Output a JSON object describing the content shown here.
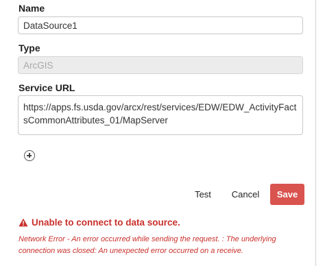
{
  "form": {
    "name_label": "Name",
    "name_value": "DataSource1",
    "type_label": "Type",
    "type_value": "ArcGIS",
    "url_label": "Service URL",
    "url_value": "https://apps.fs.usda.gov/arcx/rest/services/EDW/EDW_ActivityFactsCommonAttributes_01/MapServer",
    "add_icon": "plus-circle-icon"
  },
  "actions": {
    "test_label": "Test",
    "cancel_label": "Cancel",
    "save_label": "Save",
    "save_color": "#d9534f"
  },
  "error": {
    "icon": "warning-icon",
    "title": "Unable to connect to data source.",
    "detail": "Network Error - An error occurred while sending the request. : The underlying connection was closed: An unexpected error occurred on a receive.",
    "color": "#c9302c"
  }
}
